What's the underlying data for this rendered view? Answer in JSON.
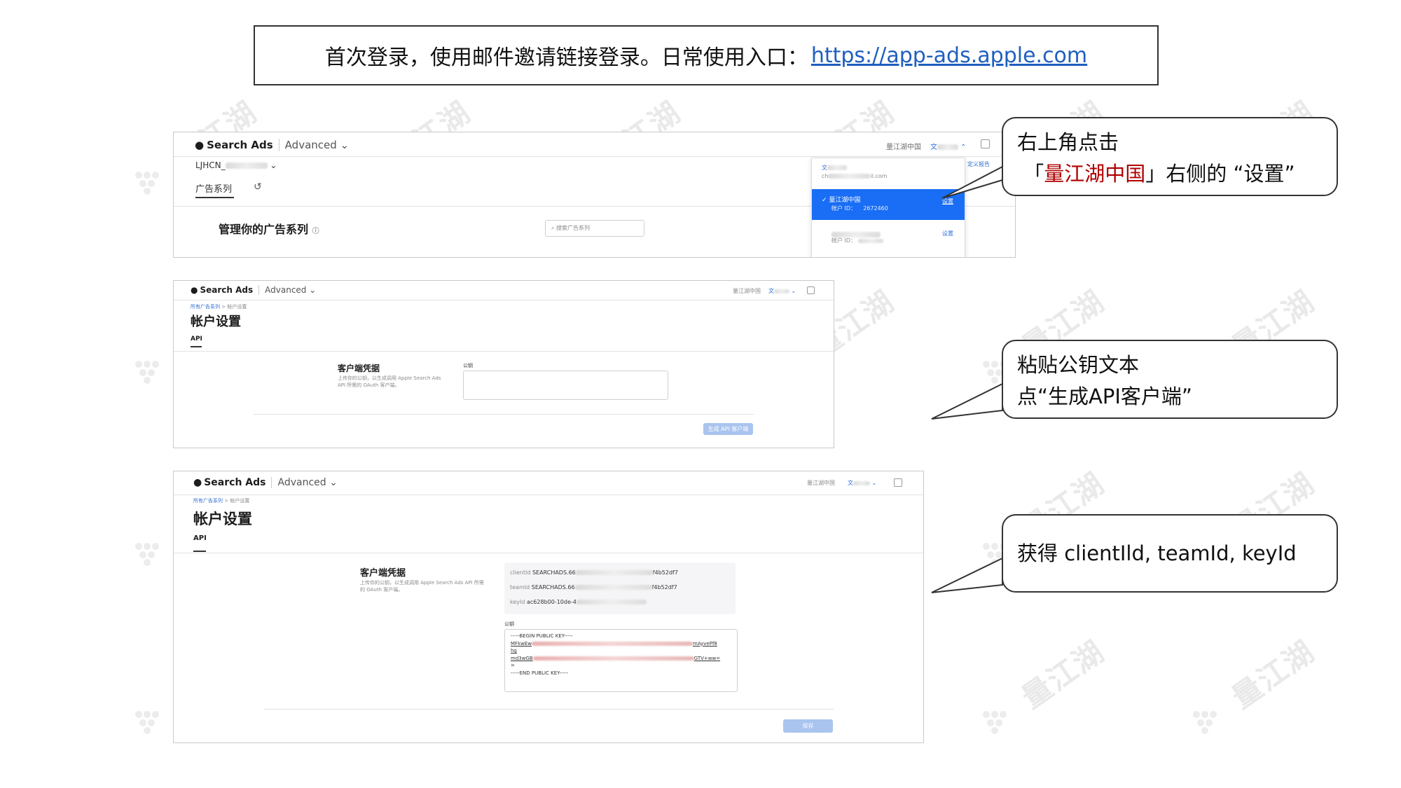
{
  "banner": {
    "text": "首次登录，使用邮件邀请链接登录。日常使用入口：",
    "link": "https://app-ads.apple.com"
  },
  "watermark": {
    "text": "量江湖"
  },
  "brand": {
    "name": "Search Ads",
    "mode": "Advanced"
  },
  "panel1": {
    "account": "LJHCN_",
    "tab_campaigns": "广告系列",
    "heading": "管理你的广告系列",
    "search_placeholder": "搜索广告系列",
    "user_org": "量江湖中国",
    "user_name": "文",
    "dropdown": {
      "email_prefix": "ch",
      "email_suffix": "il.com",
      "org_selected": "量江湖中国",
      "account_id_label": "帐户 ID：",
      "account_id": "2672460",
      "settings": "设置",
      "account_id_label2": "帐户 ID：",
      "right_edge": "定义报告"
    }
  },
  "panel2": {
    "user_org": "量江湖中国",
    "user_name": "文",
    "breadcrumb_root": "所有广告系列",
    "breadcrumb_sep": ">",
    "breadcrumb_current": "帐户设置",
    "title": "帐户设置",
    "tab_api": "API",
    "section_title": "客户端凭据",
    "section_desc": "上传你的公钥，以生成调用 Apple Search Ads API 所需的 OAuth 客户端。",
    "pubkey_label": "公钥",
    "generate_button": "生成 API 客户端"
  },
  "panel3": {
    "user_org": "量江湖中国",
    "user_name": "文",
    "breadcrumb_root": "所有广告系列",
    "breadcrumb_sep": ">",
    "breadcrumb_current": "帐户设置",
    "title": "帐户设置",
    "tab_api": "API",
    "section_title": "客户端凭据",
    "section_desc": "上传你的公钥，以生成调用 Apple Search Ads API 所需的 OAuth 客户端。",
    "client_id_label": "clientId",
    "client_id_prefix": "SEARCHADS.66",
    "client_id_suffix": "f4b52df7",
    "team_id_label": "teamId",
    "team_id_prefix": "SEARCHADS.66",
    "team_id_suffix": "f4b52df7",
    "key_id_label": "keyId",
    "key_id_prefix": "ac628b00-10de-4",
    "pubkey_label": "公钥",
    "key_begin": "-----BEGIN PUBLIC KEY-----",
    "key_line1_prefix": "MFkwEw",
    "key_line1_suffix": "mAyvePf8",
    "key_line2": "hg",
    "key_line3_prefix": "md3wGB",
    "key_line3_suffix": "GTV+ww=",
    "key_line4": "=",
    "key_end": "-----END PUBLIC KEY-----",
    "save_button": "保存"
  },
  "callouts": {
    "c1_line1": "右上角点击",
    "c1_open": "「",
    "c1_highlight": "量江湖中国",
    "c1_close": "」右侧的",
    "c1_quoted": "“设置”",
    "c2_line1": "粘贴公钥文本",
    "c2_line2": "点“生成API客户端”",
    "c3_line1": "获得 clientIld, teamId, keyId"
  },
  "colors": {
    "link": "#1f5fbf",
    "highlight": "#b00000",
    "selected_row": "#1a6ef5"
  }
}
